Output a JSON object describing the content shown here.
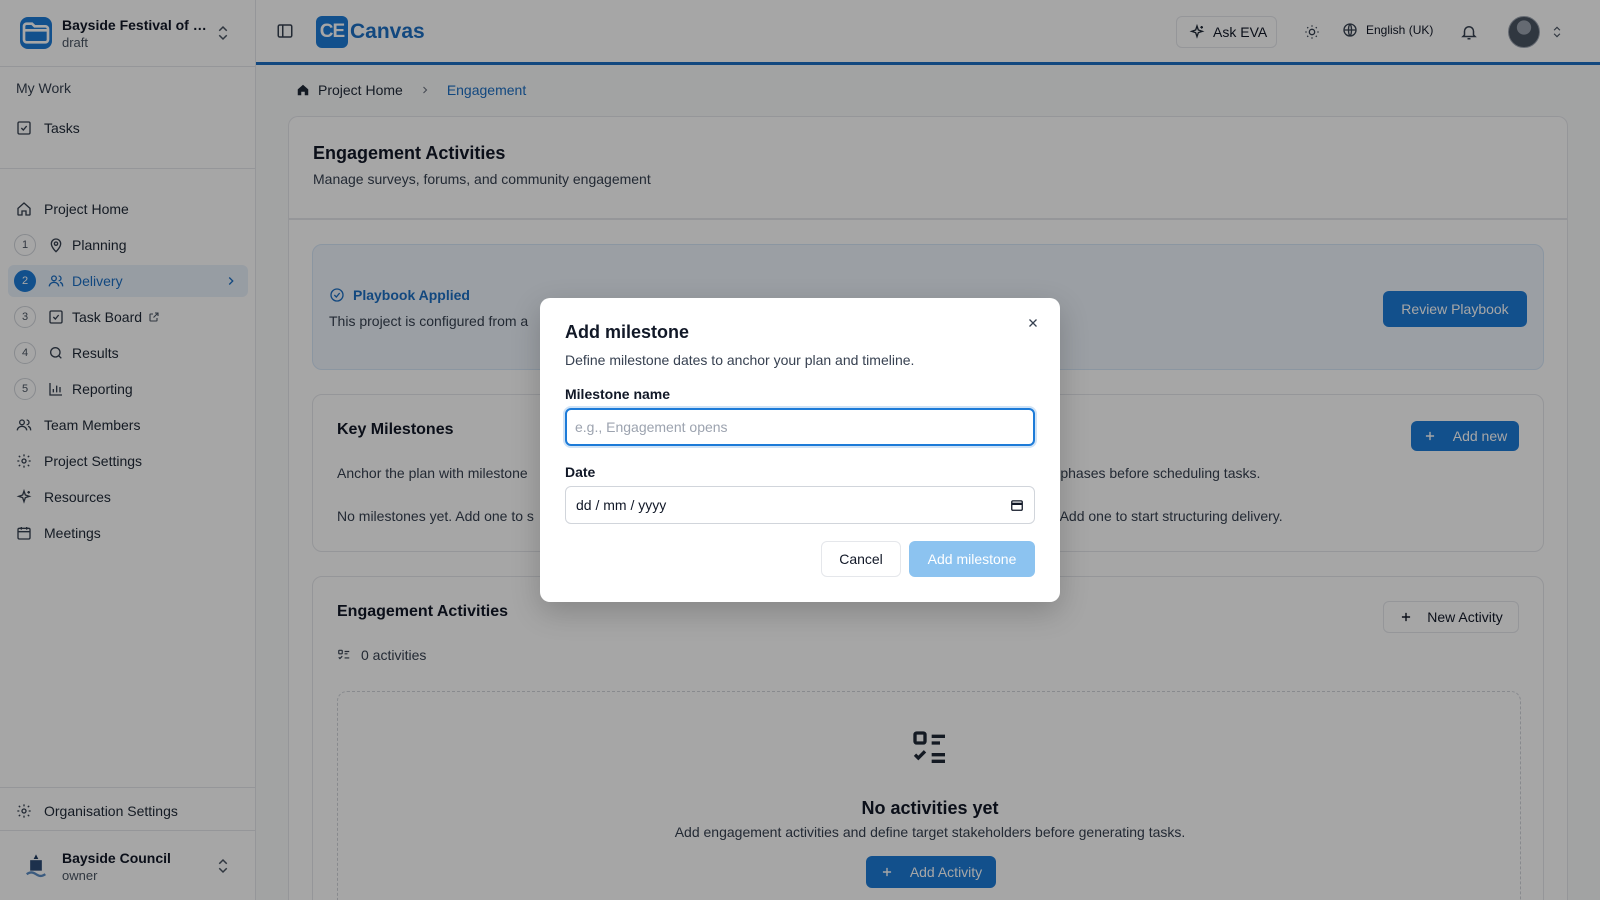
{
  "sidebar": {
    "project": {
      "name": "Bayside Festival of Li...",
      "status": "draft"
    },
    "section_label": "My Work",
    "tasks_label": "Tasks",
    "project_home": "Project Home",
    "steps": [
      {
        "num": "1",
        "label": "Planning"
      },
      {
        "num": "2",
        "label": "Delivery"
      },
      {
        "num": "3",
        "label": "Task Board"
      },
      {
        "num": "4",
        "label": "Results"
      },
      {
        "num": "5",
        "label": "Reporting"
      }
    ],
    "team_members": "Team Members",
    "project_settings": "Project Settings",
    "resources": "Resources",
    "meetings": "Meetings",
    "org_settings": "Organisation Settings",
    "org": {
      "name": "Bayside Council",
      "role": "owner"
    },
    "active_color": "#1d7bd8"
  },
  "header": {
    "brand_mark": "CE",
    "brand_text": "Canvas",
    "ask_eva": "Ask EVA",
    "language": "English (UK)"
  },
  "breadcrumb": {
    "home": "Project Home",
    "current": "Engagement"
  },
  "page": {
    "title": "Engagement Activities",
    "subtitle": "Manage surveys, forums, and community engagement"
  },
  "playbook": {
    "title": "Playbook Applied",
    "desc": "This project is configured from a",
    "button": "Review Playbook"
  },
  "milestones": {
    "title": "Key Milestones",
    "desc_left": "Anchor the plan with milestone",
    "desc_right": "k into phases before scheduling tasks.",
    "empty_left": "No milestones yet. Add one to s",
    "empty_right": "s yet. Add one to start structuring delivery.",
    "add_button": "Add new"
  },
  "activities": {
    "title": "Engagement Activities",
    "new_button": "New Activity",
    "count": "0 activities",
    "empty_title": "No activities yet",
    "empty_desc": "Add engagement activities and define target stakeholders before generating tasks.",
    "add_button": "Add Activity"
  },
  "modal": {
    "title": "Add milestone",
    "desc": "Define milestone dates to anchor your plan and timeline.",
    "name_label": "Milestone name",
    "name_placeholder": "e.g., Engagement opens",
    "name_value": "",
    "date_label": "Date",
    "date_placeholder": "dd / mm / yyyy",
    "cancel": "Cancel",
    "submit": "Add milestone"
  }
}
